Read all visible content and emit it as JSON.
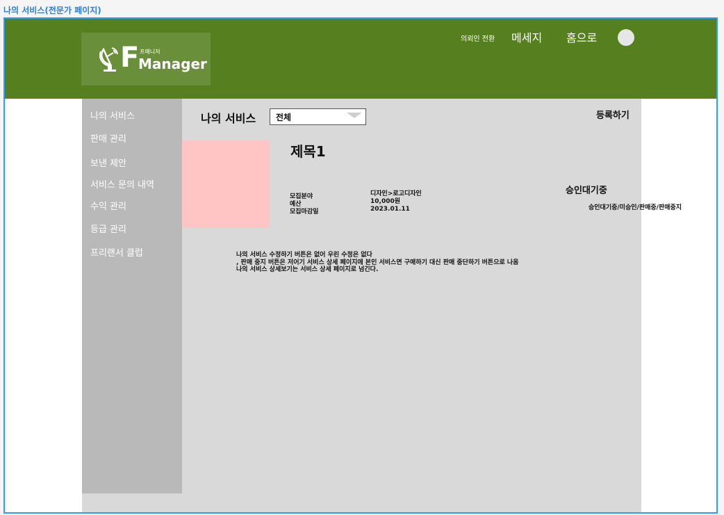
{
  "frame_label": "나의 서비스(전문가 페이지)",
  "header": {
    "logo": {
      "small_text": "프매니저",
      "brand_text": "Manager",
      "brand_initial": "F"
    },
    "switch_label": "의뢰인 전환",
    "message_label": "메세지",
    "home_label": "홈으로",
    "bg_color": "#56801f"
  },
  "sidebar": {
    "items": [
      {
        "label": "나의 서비스"
      },
      {
        "label": "판매 관리"
      },
      {
        "label": "보낸 제안"
      },
      {
        "label": "서비스 문의 내역"
      },
      {
        "label": "수익 관리"
      },
      {
        "label": "등급 관리"
      },
      {
        "label": "프리랜서 클럽"
      }
    ]
  },
  "main": {
    "title": "나의 서비스",
    "filter": {
      "selected": "전체"
    },
    "register_label": "등록하기",
    "service": {
      "title": "제목1",
      "fields": [
        {
          "label": "모집분야",
          "value": "디자인>로고디자인"
        },
        {
          "label": "예산",
          "value": "10,000원"
        },
        {
          "label": "모집마감일",
          "value": "2023.01.11"
        }
      ],
      "status": "승인대기중",
      "status_options": "승인대기중/미승인/판매중/판매중지"
    },
    "notes": [
      "나의 서비스 수정하기 버튼은 없어 우린 수정은 없다",
      ", 판매 중지 버튼은 저어기 서비스 상세 페이지에 본인 서비스면 구매하기  대신 판매 중단하기 버튼으로 나옴",
      "나의 서비스 상세보기는 서비스 상세 페이지로 넘긴다."
    ]
  }
}
